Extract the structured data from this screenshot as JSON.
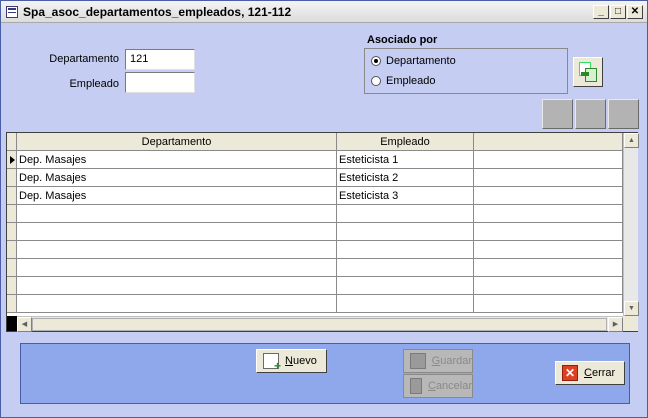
{
  "window": {
    "title": "Spa_asoc_departamentos_empleados, 121-112",
    "controls": {
      "minimize": "_",
      "maximize": "□",
      "close": "✕"
    }
  },
  "form": {
    "departamento_label": "Departamento",
    "departamento_value": "121",
    "empleado_label": "Empleado",
    "empleado_value": ""
  },
  "asociado": {
    "title": "Asociado por",
    "options": [
      {
        "label": "Departamento",
        "selected": true
      },
      {
        "label": "Empleado",
        "selected": false
      }
    ]
  },
  "grid": {
    "columns": [
      "Departamento",
      "Empleado",
      ""
    ],
    "rows": [
      [
        "Dep. Masajes",
        "Esteticista 1",
        ""
      ],
      [
        "Dep. Masajes",
        "Esteticista 2",
        ""
      ],
      [
        "Dep. Masajes",
        "Esteticista 3",
        ""
      ]
    ],
    "current_row": 0
  },
  "buttons": {
    "nuevo": {
      "label": "Nuevo",
      "underline": "N",
      "rest": "uevo"
    },
    "guardar": {
      "label": "Guardar",
      "underline": "G",
      "rest": "uardar",
      "enabled": false
    },
    "cancelar": {
      "label": "Cancelar",
      "underline": "C",
      "rest": "ancelar",
      "enabled": false
    },
    "cerrar": {
      "label": "Cerrar",
      "underline": "C",
      "rest": "errar"
    }
  },
  "colors": {
    "form_bg": "#c5cdf2",
    "panel_bg": "#8fa8ec"
  }
}
